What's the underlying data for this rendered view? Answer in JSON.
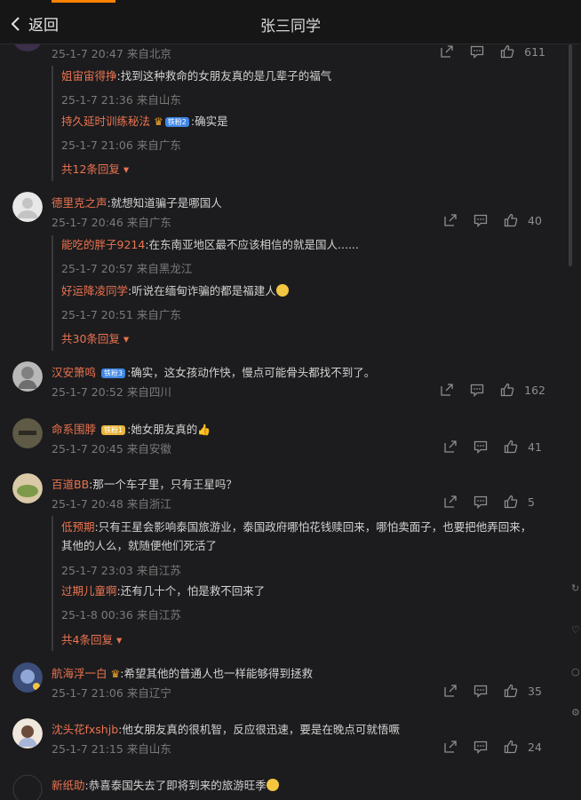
{
  "header": {
    "back_label": "返回",
    "title": "张三同学"
  },
  "comments": [
    {
      "user": "",
      "text": "",
      "time": "25-1-7 20:47",
      "location": "来自北京",
      "likes": "611",
      "replies": [
        {
          "user": "姐宙宙得挣",
          "text": ":找到这种救命的女朋友真的是几辈子的福气",
          "time": "25-1-7 21:36",
          "location": "来自山东"
        },
        {
          "user": "持久延时训练秘法",
          "badge": "铁粉2",
          "text": ":确实是",
          "time": "25-1-7 21:06",
          "location": "来自广东"
        }
      ],
      "more": "共12条回复"
    },
    {
      "user": "德里克之声",
      "text": ":就想知道骗子是哪国人",
      "time": "25-1-7 20:46",
      "location": "来自广东",
      "likes": "40",
      "replies": [
        {
          "user": "能吃的胖子9214",
          "text": ":在东南亚地区最不应该相信的就是国人......",
          "time": "25-1-7 20:57",
          "location": "来自黑龙江"
        },
        {
          "user": "好运降凌同学",
          "text": ":听说在缅甸诈骗的都是福建人",
          "time": "25-1-7 20:51",
          "location": "来自广东"
        }
      ],
      "more": "共30条回复"
    },
    {
      "user": "汉安箫鸣",
      "badge": "铁粉3",
      "text": ":确实，这女孩动作快，慢点可能骨头都找不到了。",
      "time": "25-1-7 20:52",
      "location": "来自四川",
      "likes": "162"
    },
    {
      "user": "命系围脖",
      "badge": "铁粉1",
      "text": ":她女朋友真的",
      "time": "25-1-7 20:45",
      "location": "来自安徽",
      "likes": "41"
    },
    {
      "user": "百道BB",
      "text": ":那一个车子里，只有王星吗？",
      "time": "25-1-7 20:48",
      "location": "来自浙江",
      "likes": "5",
      "replies": [
        {
          "user": "低预期",
          "text": ":只有王星会影响泰国旅游业，泰国政府哪怕花钱赎回来，哪怕卖面子，也要把他弄回来，其他的人么，就随便他们死活了",
          "time": "25-1-7 23:03",
          "location": "来自江苏"
        },
        {
          "user": "过期儿童啊",
          "text": ":还有几十个，怕是救不回来了",
          "time": "25-1-8 00:36",
          "location": "来自江苏"
        }
      ],
      "more": "共4条回复"
    },
    {
      "user": "航海浮一白",
      "text": ":希望其他的普通人也一样能够得到拯救",
      "time": "25-1-7 21:06",
      "location": "来自辽宁",
      "likes": "35"
    },
    {
      "user": "沈头花fxshjb",
      "text": ":他女朋友真的很机智，反应很迅速，要是在晚点可就悟噘",
      "time": "25-1-7 21:15",
      "location": "来自山东",
      "likes": "24"
    },
    {
      "user": "新纸助",
      "text": ":恭喜泰国失去了即将到来的旅游旺季",
      "time": "",
      "location": "",
      "likes": ""
    }
  ],
  "colors": {
    "accent": "#ff8200",
    "username": "#eb7350",
    "background": "#1c1c1e"
  },
  "icons": [
    "chevron-left-icon",
    "share-icon",
    "comment-icon",
    "thumbs-up-icon"
  ]
}
